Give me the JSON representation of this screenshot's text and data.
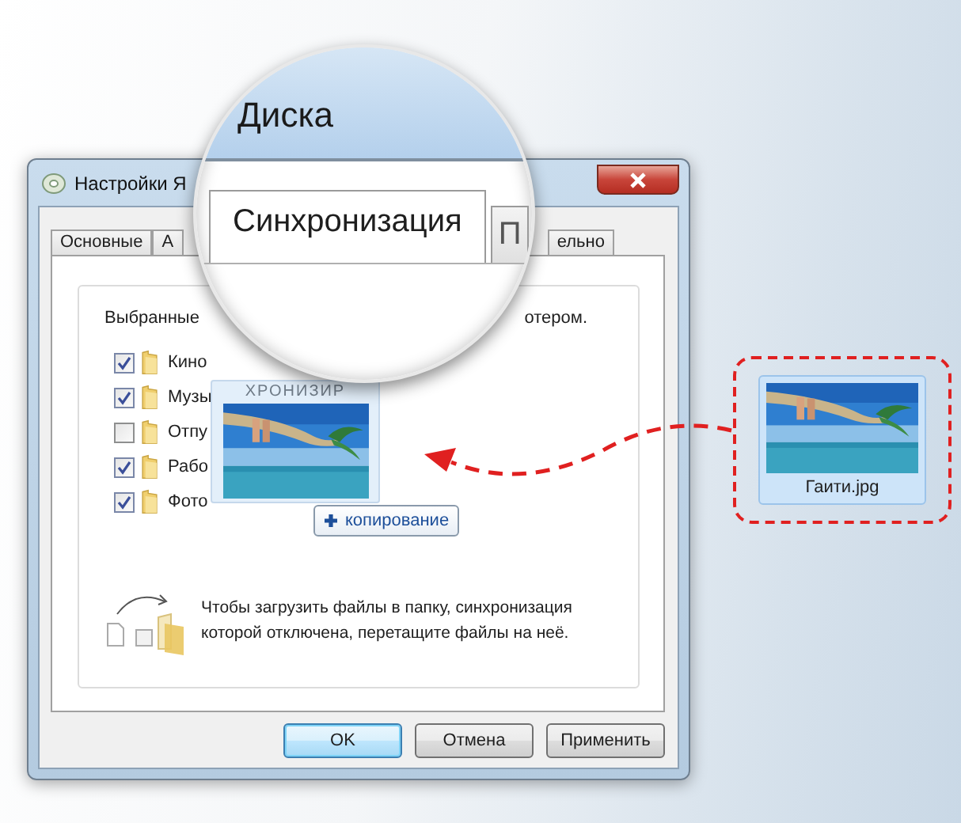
{
  "dialog": {
    "title": "Настройки Я",
    "tabs": [
      {
        "label": "Основные",
        "selected": false
      },
      {
        "label": "А",
        "selected": false
      },
      {
        "label": "ельно",
        "selected": false
      }
    ],
    "intro_start": "Выбранные",
    "intro_end": "отером.",
    "folders": [
      {
        "label": "Кино",
        "checked": true
      },
      {
        "label": "Музы",
        "checked": true
      },
      {
        "label": "Отпу",
        "checked": false
      },
      {
        "label": "Рабо",
        "checked": true
      },
      {
        "label": "Фото",
        "checked": true
      }
    ],
    "hint": "Чтобы загрузить файлы в папку, синхронизация которой отключена, перетащите файлы на неё.",
    "buttons": [
      {
        "label": "OK",
        "default": true
      },
      {
        "label": "Отмена",
        "default": false
      },
      {
        "label": "Применить",
        "default": false
      }
    ]
  },
  "magnifier": {
    "title": "Диска",
    "tabs": [
      {
        "label": "Синхронизация",
        "selected": true
      },
      {
        "label": "П",
        "selected": false
      }
    ]
  },
  "drag_ghost": {
    "caption": "ХРОНИЗИР",
    "badge": "копирование"
  },
  "file": {
    "name": "Гаити.jpg",
    "selected": true
  }
}
